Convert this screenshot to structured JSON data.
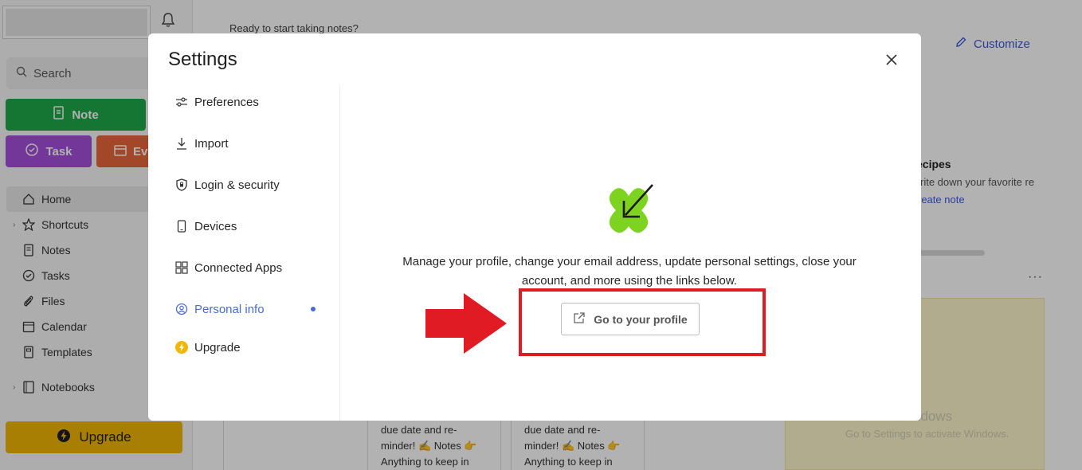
{
  "sidebar": {
    "search_placeholder": "Search",
    "buttons": {
      "note": "Note",
      "task": "Task",
      "event": "Ev"
    },
    "nav": [
      {
        "label": "Home"
      },
      {
        "label": "Shortcuts"
      },
      {
        "label": "Notes"
      },
      {
        "label": "Tasks"
      },
      {
        "label": "Files"
      },
      {
        "label": "Calendar"
      },
      {
        "label": "Templates"
      }
    ],
    "notebooks": "Notebooks",
    "upgrade": "Upgrade"
  },
  "main": {
    "prompt": "Ready to start taking notes?",
    "customize": "Customize",
    "recipes": {
      "title": "ecipes",
      "desc": "rite down your favorite re",
      "link": "reate note"
    },
    "note_cards": [
      {
        "lines": [
          "due date and re-",
          "minder! ✍️ Notes 👉",
          "Anything to keep in"
        ]
      },
      {
        "lines": [
          "due date and re-",
          "minder! ✍️ Notes 👉",
          "Anything to keep in"
        ]
      }
    ],
    "watermark": {
      "title": "Activate Windows",
      "subtitle": "Go to Settings to activate Windows."
    }
  },
  "modal": {
    "title": "Settings",
    "menu": [
      {
        "label": "Preferences",
        "icon": "sliders-icon"
      },
      {
        "label": "Import",
        "icon": "download-icon"
      },
      {
        "label": "Login & security",
        "icon": "shield-icon"
      },
      {
        "label": "Devices",
        "icon": "phone-icon"
      },
      {
        "label": "Connected Apps",
        "icon": "apps-grid-icon"
      },
      {
        "label": "Personal info",
        "icon": "person-circle-icon",
        "active": true
      },
      {
        "label": "Upgrade",
        "icon": "bolt-icon"
      }
    ],
    "description": "Manage your profile, change your email address, update personal settings, close your account, and more using the links below.",
    "profile_button": "Go to your profile"
  },
  "colors": {
    "accent": "#4a6bd6",
    "highlight": "#e01b24",
    "note_green": "#1fa84a",
    "task_purple": "#a44fdc",
    "event_orange": "#e9683a",
    "upgrade_yellow": "#f2b705",
    "logo_green": "#7ed321"
  }
}
